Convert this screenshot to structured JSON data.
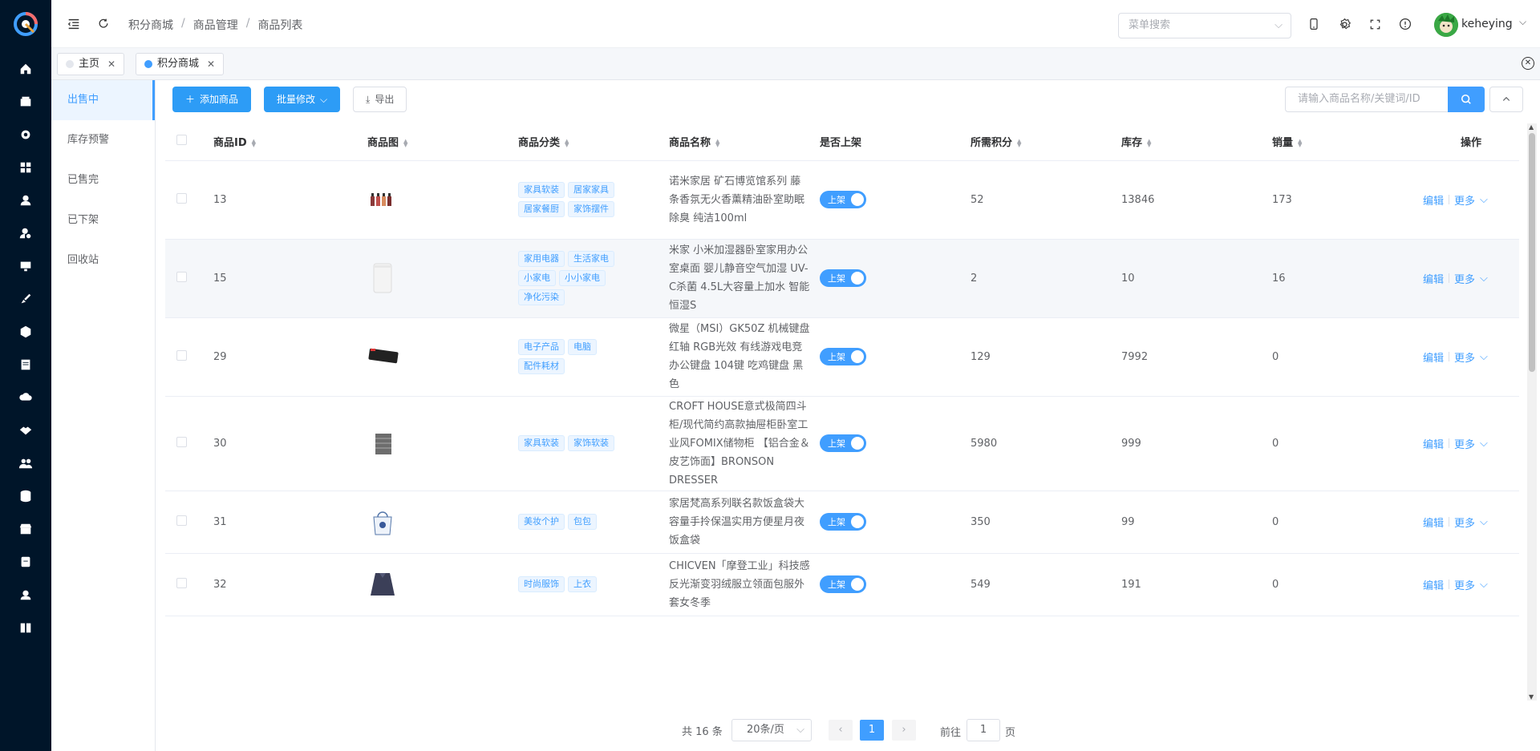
{
  "brand": {
    "logo_icon": "chart-logo-icon",
    "accent": "#409eff",
    "dark": "#001529"
  },
  "nav_icons": [
    "home-icon",
    "box-icon",
    "gear-icon",
    "grid-icon",
    "user-icon",
    "user-settings-icon",
    "monitor-icon",
    "brush-icon",
    "cube-icon",
    "document-icon",
    "cloud-download-icon",
    "handshake-icon",
    "users-icon",
    "database-icon",
    "store-icon",
    "page-icon",
    "badge-user-icon",
    "book-icon"
  ],
  "header": {
    "breadcrumb": [
      "积分商城",
      "商品管理",
      "商品列表"
    ],
    "menu_search_placeholder": "菜单搜索",
    "username": "keheying"
  },
  "tabs": [
    {
      "label": "主页",
      "active": false
    },
    {
      "label": "积分商城",
      "active": true
    }
  ],
  "sidemenu": [
    "出售中",
    "库存预警",
    "已售完",
    "已下架",
    "回收站"
  ],
  "toolbar": {
    "add_label": "添加商品",
    "batch_label": "批量修改",
    "export_label": "导出",
    "search_placeholder": "请输入商品名称/关键词/ID"
  },
  "table": {
    "columns": [
      "商品ID",
      "商品图",
      "商品分类",
      "商品名称",
      "是否上架",
      "所需积分",
      "库存",
      "销量",
      "操作"
    ],
    "switch_label": "上架",
    "edit_label": "编辑",
    "more_label": "更多",
    "rows": [
      {
        "id": "13",
        "image_icon": "oil-bottles-icon",
        "cats": [
          "家具软装",
          "居家家具",
          "居家餐厨",
          "家饰摆件"
        ],
        "name": "诺米家居 矿石博览馆系列 藤条香氛无火香薰精油卧室助眠除臭 纯洁100ml",
        "points": "52",
        "stock": "13846",
        "sales": "173"
      },
      {
        "id": "15",
        "image_icon": "humidifier-icon",
        "cats": [
          "家用电器",
          "生活家电",
          "小家电",
          "小小家电",
          "净化污染"
        ],
        "name": "米家 小米加湿器卧室家用办公室桌面 婴儿静音空气加湿 UV-C杀菌 4.5L大容量上加水 智能恒湿S",
        "points": "2",
        "stock": "10",
        "sales": "16"
      },
      {
        "id": "29",
        "image_icon": "keyboard-icon",
        "cats": [
          "电子产品",
          "电脑",
          "配件耗材"
        ],
        "name": "微星（MSI）GK50Z 机械键盘 红轴 RGB光效 有线游戏电竞办公键盘 104键 吃鸡键盘 黑色",
        "points": "129",
        "stock": "7992",
        "sales": "0"
      },
      {
        "id": "30",
        "image_icon": "dresser-icon",
        "cats": [
          "家具软装",
          "家饰软装"
        ],
        "name": "CROFT HOUSE意式极简四斗柜/现代简约高款抽屉柜卧室工业风FOMIX储物柜 【铝合金＆皮艺饰面】BRONSON DRESSER",
        "points": "5980",
        "stock": "999",
        "sales": "0"
      },
      {
        "id": "31",
        "image_icon": "lunch-bag-icon",
        "cats": [
          "美妆个护",
          "包包"
        ],
        "name": "家居梵高系列联名款饭盒袋大容量手拎保温实用方便星月夜饭盒袋",
        "points": "350",
        "stock": "99",
        "sales": "0"
      },
      {
        "id": "32",
        "image_icon": "down-jacket-icon",
        "cats": [
          "时尚服饰",
          "上衣"
        ],
        "name": "CHICVEN「摩登工业」科技感反光渐变羽绒服立领面包服外套女冬季",
        "points": "549",
        "stock": "191",
        "sales": "0"
      }
    ]
  },
  "pagination": {
    "total_label": "共 16 条",
    "page_size": "20条/页",
    "current_page": "1",
    "goto_label": "前往",
    "goto_value": "1",
    "page_unit": "页"
  }
}
